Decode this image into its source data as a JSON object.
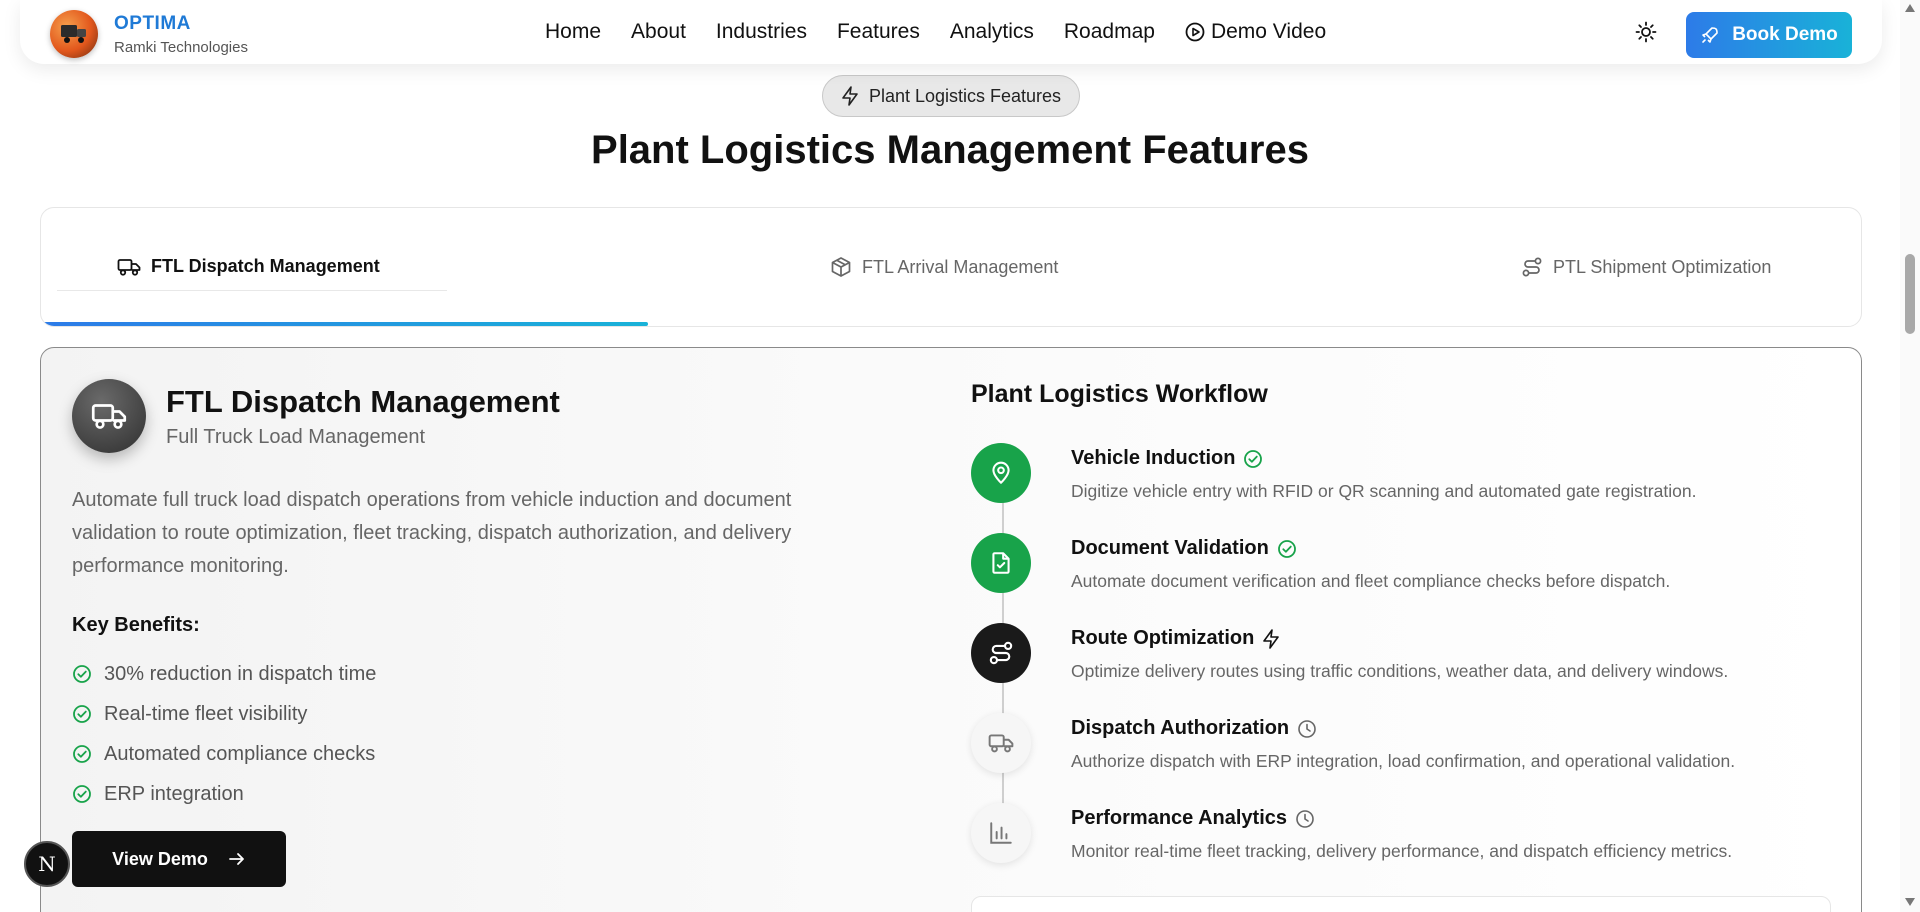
{
  "header": {
    "brand_name": "OPTIMA",
    "brand_sub": "Ramki Technologies",
    "nav": [
      "Home",
      "About",
      "Industries",
      "Features",
      "Analytics",
      "Roadmap",
      "Demo Video"
    ],
    "book_label": "Book Demo",
    "accent": "#2d7be8"
  },
  "section": {
    "badge": "Plant Logistics Features",
    "title": "Plant Logistics Management Features"
  },
  "tabs": [
    {
      "label": "FTL Dispatch Management",
      "icon": "truck-icon",
      "active": true
    },
    {
      "label": "FTL Arrival Management",
      "icon": "package-icon",
      "active": false
    },
    {
      "label": "PTL Shipment Optimization",
      "icon": "route-icon",
      "active": false
    }
  ],
  "card": {
    "title": "FTL Dispatch Management",
    "subtitle": "Full Truck Load Management",
    "description": "Automate full truck load dispatch operations from vehicle induction and document validation to route optimization, fleet tracking, dispatch authorization, and delivery performance monitoring.",
    "benefits_title": "Key Benefits:",
    "benefits": [
      "30% reduction in dispatch time",
      "Real-time fleet visibility",
      "Automated compliance checks",
      "ERP integration"
    ],
    "view_label": "View Demo"
  },
  "workflow": {
    "title": "Plant Logistics Workflow",
    "steps": [
      {
        "name": "Vehicle Induction",
        "desc": "Digitize vehicle entry with RFID or QR scanning and automated gate registration.",
        "status": "done",
        "icon": "map-pin-icon"
      },
      {
        "name": "Document Validation",
        "desc": "Automate document verification and fleet compliance checks before dispatch.",
        "status": "done",
        "icon": "file-check-icon"
      },
      {
        "name": "Route Optimization",
        "desc": "Optimize delivery routes using traffic conditions, weather data, and delivery windows.",
        "status": "current",
        "icon": "route-icon"
      },
      {
        "name": "Dispatch Authorization",
        "desc": "Authorize dispatch with ERP integration, load confirmation, and operational validation.",
        "status": "pending",
        "icon": "truck-icon"
      },
      {
        "name": "Performance Analytics",
        "desc": "Monitor real-time fleet tracking, delivery performance, and dispatch efficiency metrics.",
        "status": "pending",
        "icon": "bar-chart-icon"
      }
    ]
  },
  "floating": {
    "letter": "N"
  },
  "colors": {
    "done": "#18a34a",
    "current": "#1a1a1a",
    "pending": "#f6f6f6"
  }
}
